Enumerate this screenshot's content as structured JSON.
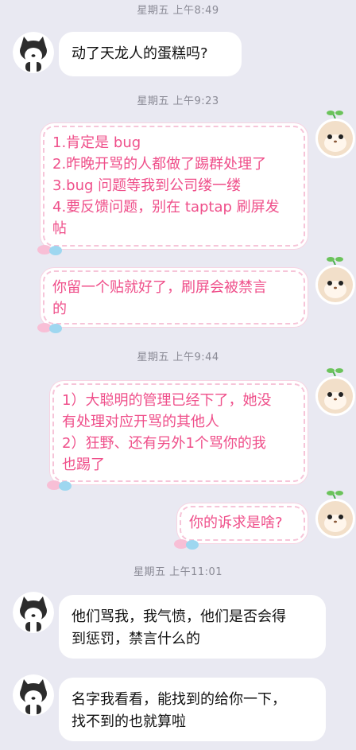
{
  "timestamps": {
    "t1": "星期五 上午8:49",
    "t2": "星期五 上午9:23",
    "t3": "星期五 上午9:44",
    "t4": "星期五 上午11:01"
  },
  "messages": {
    "m1": "动了天龙人的蛋糕吗?",
    "m2_line1": "1.肯定是 bug",
    "m2_line2": "2.昨晚开骂的人都做了踢群处理了",
    "m2_line3": "3.bug 问题等我到公司缕一缕",
    "m2_line4": "4.要反馈问题，别在 taptap 刷屏发",
    "m2_line5": "帖",
    "m3_line1": "你留一个贴就好了，刷屏会被禁言",
    "m3_line2": "的",
    "m4_line1": "1）大聪明的管理已经下了，她没",
    "m4_line2": "有处理对应开骂的其他人",
    "m4_line3": "2）狂野、还有另外1个骂你的我",
    "m4_line4": "也踢了",
    "m5": "你的诉求是啥?",
    "m6_line1": "他们骂我，我气愤，他们是否会得",
    "m6_line2": "到惩罚，禁言什么的",
    "m7_line1": "名字我看看，能找到的给你一下，",
    "m7_line2": "找不到的也就算啦"
  },
  "colors": {
    "background": "#e9e9f2",
    "incoming_text": "#111111",
    "outgoing_text": "#ef4f8a",
    "timestamp": "#8a8a95"
  },
  "icons": {
    "incoming_avatar": "husky-dog-avatar",
    "outgoing_avatar": "hamster-sprout-avatar"
  }
}
